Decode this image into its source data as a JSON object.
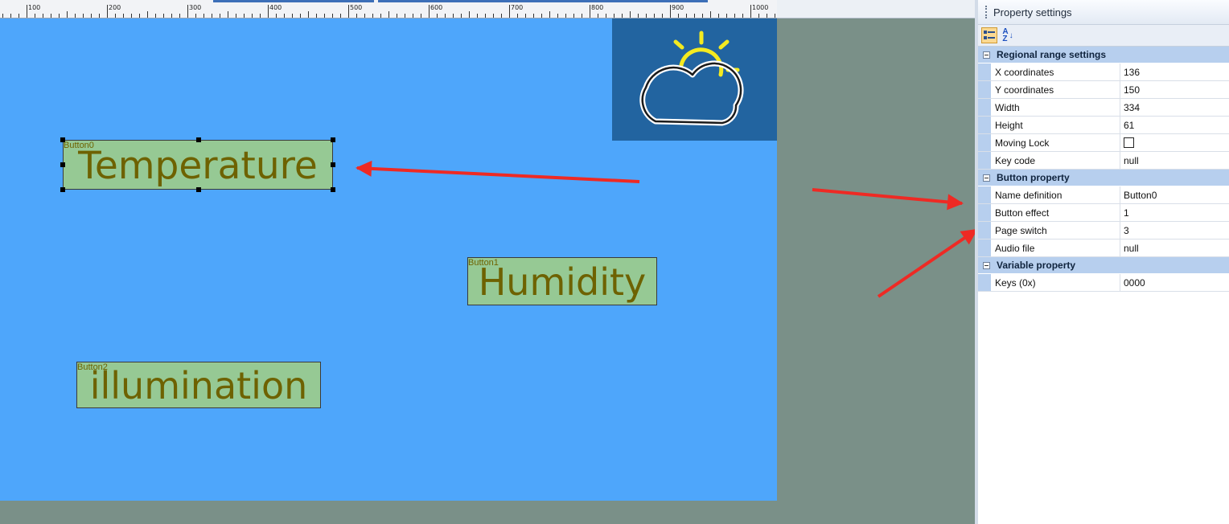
{
  "ruler": {
    "labels": [
      "100",
      "200",
      "300",
      "400",
      "500",
      "600",
      "700",
      "800",
      "900",
      "1000"
    ]
  },
  "canvas": {
    "buttons": [
      {
        "tag": "Button0",
        "caption": "Temperature"
      },
      {
        "tag": "Button1",
        "caption": "Humidity"
      },
      {
        "tag": "Button2",
        "caption": "illumination"
      }
    ],
    "weather_icon": "partly-cloudy-icon"
  },
  "panel": {
    "title": "Property settings",
    "toolbar": {
      "categorized_icon": "categorized-icon",
      "alphabetical_icon": "sort-az-icon",
      "alphabetical_glyph_top": "A",
      "alphabetical_glyph_bottom": "Z"
    },
    "categories": [
      {
        "label": "Regional range settings",
        "rows": [
          {
            "name": "X coordinates",
            "value": "136"
          },
          {
            "name": "Y coordinates",
            "value": "150"
          },
          {
            "name": "Width",
            "value": "334"
          },
          {
            "name": "Height",
            "value": "61"
          },
          {
            "name": "Moving Lock",
            "value": ""
          },
          {
            "name": "Key code",
            "value": "null"
          }
        ]
      },
      {
        "label": "Button property",
        "rows": [
          {
            "name": "Name definition",
            "value": "Button0"
          },
          {
            "name": "Button effect",
            "value": "1"
          },
          {
            "name": "Page switch",
            "value": "3"
          },
          {
            "name": "Audio file",
            "value": "null"
          }
        ]
      },
      {
        "label": "Variable property",
        "rows": [
          {
            "name": "Keys (0x)",
            "value": "0000"
          }
        ]
      }
    ],
    "moving_lock_checked": false
  },
  "colors": {
    "canvas_bg": "#4ea6fb",
    "button_fill": "#96c994",
    "button_text": "#6e6200",
    "annotation_arrow": "#ee2a24",
    "weather_tile": "#2264a0",
    "sun_yellow": "#f4ea20"
  }
}
